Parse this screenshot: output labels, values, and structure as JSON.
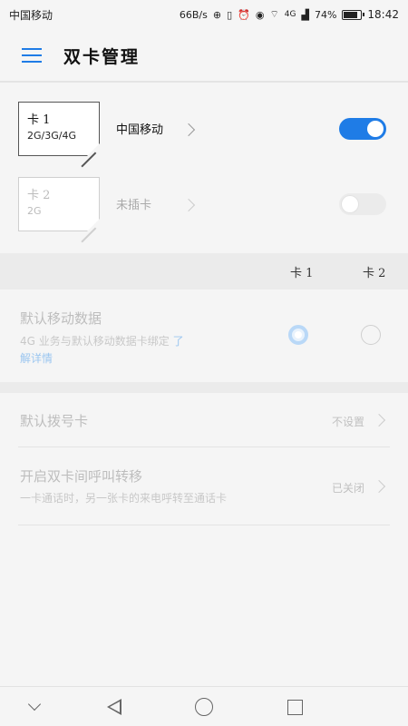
{
  "status_bar": {
    "carrier": "中国移动",
    "speed": "66B/s",
    "network": "4G",
    "battery_percent": "74%",
    "battery_level": 0.74,
    "time": "18:42"
  },
  "header": {
    "title": "双卡管理"
  },
  "sims": [
    {
      "card_name": "卡 1",
      "card_types": "2G/3G/4G",
      "carrier": "中国移动",
      "enabled": true
    },
    {
      "card_name": "卡 2",
      "card_types": "2G",
      "carrier": "未插卡",
      "enabled": false
    }
  ],
  "columns": {
    "sim1": "卡 1",
    "sim2": "卡 2"
  },
  "default_data": {
    "title": "默认移动数据",
    "desc_line1": "4G 业务与默认移动数据卡绑定",
    "link_part1": "了",
    "link_part2": "解详情"
  },
  "default_dial": {
    "title": "默认拨号卡",
    "value": "不设置"
  },
  "call_forward": {
    "title": "开启双卡间呼叫转移",
    "desc": "一卡通话时，另一张卡的来电呼转至通话卡",
    "value": "已关闭"
  },
  "colors": {
    "accent": "#1f7ce6",
    "muted_text": "#bdbdbd",
    "background": "#f5f5f5"
  }
}
